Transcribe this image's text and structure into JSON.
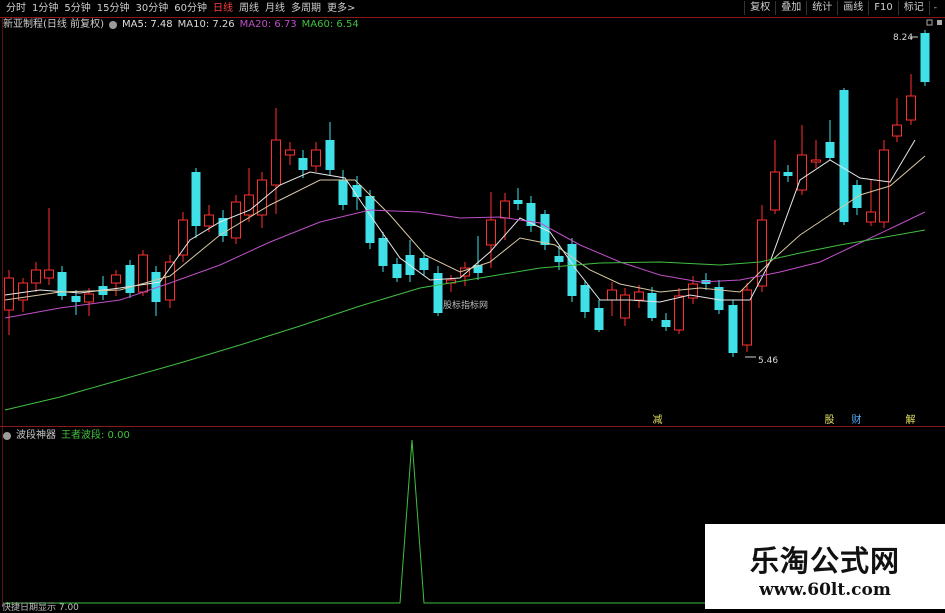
{
  "toolbar": {
    "periods": [
      "分时",
      "1分钟",
      "5分钟",
      "15分钟",
      "30分钟",
      "60分钟",
      "日线",
      "周线",
      "月线",
      "多周期",
      "更多>"
    ],
    "active_period": "日线",
    "right_tools": [
      "复权",
      "叠加",
      "统计",
      "画线",
      "F10",
      "标记",
      "-"
    ]
  },
  "main_panel": {
    "title": "新亚制程(日线 前复权)",
    "ma_items": [
      {
        "label": "MA5: 7.48",
        "color": "#e0e0e0"
      },
      {
        "label": "MA10: 7.26",
        "color": "#d8d8d8"
      },
      {
        "label": "MA20: 6.73",
        "color": "#c050c8"
      },
      {
        "label": "MA60: 6.54",
        "color": "#40c040"
      }
    ],
    "high_label": "8.24",
    "low_label": "5.46",
    "overlay_text": "股标指标网",
    "markers": [
      {
        "text": "减",
        "color": "#e0e060"
      },
      {
        "text": "股",
        "color": "#e0e060"
      },
      {
        "text": "财",
        "color": "#50b0ff"
      },
      {
        "text": "解",
        "color": "#e0e060"
      }
    ]
  },
  "sub_panel": {
    "title": "波段神器",
    "value_label": "王者波段: 0.00",
    "value_color": "#40c040"
  },
  "bottom_text": "快捷日期显示 7.00",
  "watermark": {
    "name": "乐淘公式网",
    "url": "www.60lt.com"
  },
  "colors": {
    "up": "#ff3030",
    "down": "#40e0e8",
    "ma5": "#e8e8e8",
    "ma10": "#d8c8a0",
    "ma20": "#c050c8",
    "ma60": "#40c040"
  }
}
